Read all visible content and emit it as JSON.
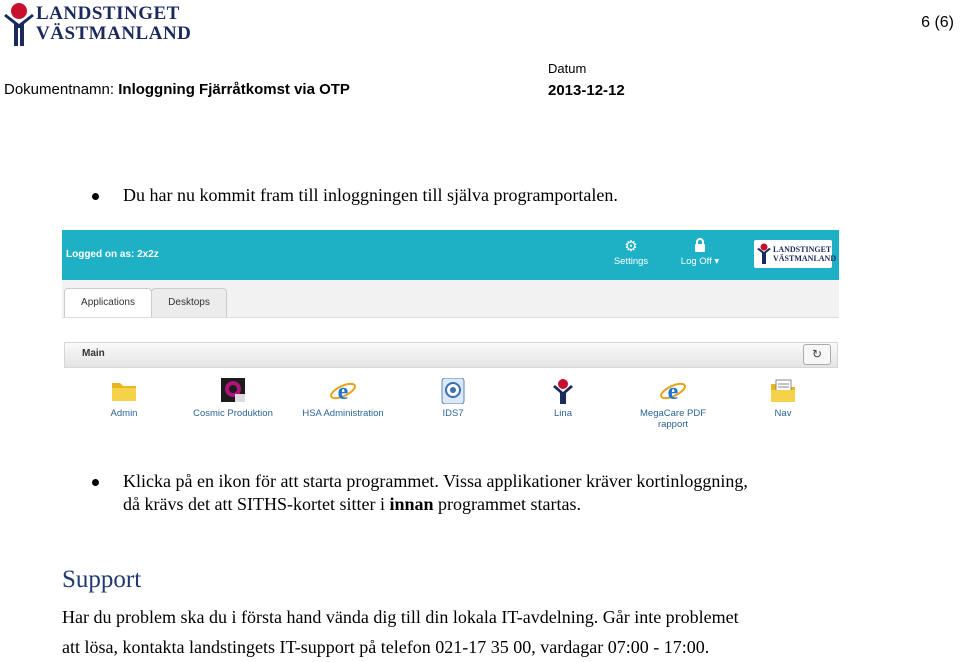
{
  "header": {
    "logo_line1": "LANDSTINGET",
    "logo_line2": "VÄSTMANLAND",
    "page_number": "6 (6)",
    "docname_label": "Dokumentnamn:",
    "docname_value": "Inloggning Fjärråtkomst via OTP",
    "date_label": "Datum",
    "date_value": "2013-12-12"
  },
  "body": {
    "bullet1": "Du har nu kommit fram till inloggningen till själva programportalen.",
    "bullet2_line1": "Klicka på en ikon för att starta programmet. Vissa applikationer kräver kortinloggning,",
    "bullet2_line2_pre": "då krävs det att SITHS-kortet sitter i ",
    "bullet2_line2_bold": "innan",
    "bullet2_line2_post": " programmet startas."
  },
  "portal": {
    "logged_on": "Logged on as: 2x2z",
    "settings_label": "Settings",
    "logoff_label": "Log Off",
    "logo_line1": "LANDSTINGET",
    "logo_line2": "VÄSTMANLAND",
    "tabs": [
      "Applications",
      "Desktops"
    ],
    "section_title": "Main",
    "apps": [
      {
        "label": "Admin",
        "icon": "folder-icon"
      },
      {
        "label": "Cosmic Produktion",
        "icon": "cosmic-icon"
      },
      {
        "label": "HSA Administration",
        "icon": "ie-icon"
      },
      {
        "label": "IDS7",
        "icon": "ids7-icon"
      },
      {
        "label": "Lina",
        "icon": "landsting-icon"
      },
      {
        "label": "MegaCare PDF",
        "label2": "rapport",
        "icon": "ie-icon"
      },
      {
        "label": "Nav",
        "icon": "documents-folder-icon"
      }
    ]
  },
  "support": {
    "heading": "Support",
    "line1": "Har du problem ska du i första hand vända dig till din lokala IT-avdelning. Går inte problemet",
    "line2": "att lösa, kontakta landstingets IT-support på telefon 021-17 35 00, vardagar 07:00 - 17:00."
  },
  "colors": {
    "topbar": "#1eb0c4",
    "logo_red": "#c8102e",
    "logo_blue": "#1b2a5c",
    "support_heading": "#1f3a6e"
  }
}
